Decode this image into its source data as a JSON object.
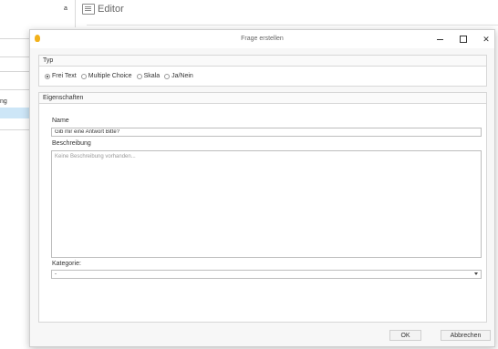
{
  "background": {
    "letter": "a",
    "editor_label": "Editor",
    "list_item": "ng"
  },
  "dialog": {
    "title": "Frage erstellen",
    "window_buttons": {
      "minimize": "–",
      "maximize": "□",
      "close": "✕"
    },
    "typ": {
      "header": "Typ",
      "options": [
        "Frei Text",
        "Multiple Choice",
        "Skala",
        "Ja/Nein"
      ],
      "selected": "Frei Text"
    },
    "eigenschaften": {
      "header": "Eigenschaften",
      "name_label": "Name",
      "name_value": "Gib mir eine Antwort Bitte?",
      "beschreibung_label": "Beschreibung",
      "beschreibung_placeholder": "Keine Beschreibung vorhanden...",
      "kategorie_label": "Kategorie:",
      "kategorie_value": "-"
    },
    "buttons": {
      "ok": "OK",
      "cancel": "Abbrechen"
    }
  },
  "colors": {
    "accent_icon": "#f2b11a",
    "selection": "#cde6f7"
  }
}
